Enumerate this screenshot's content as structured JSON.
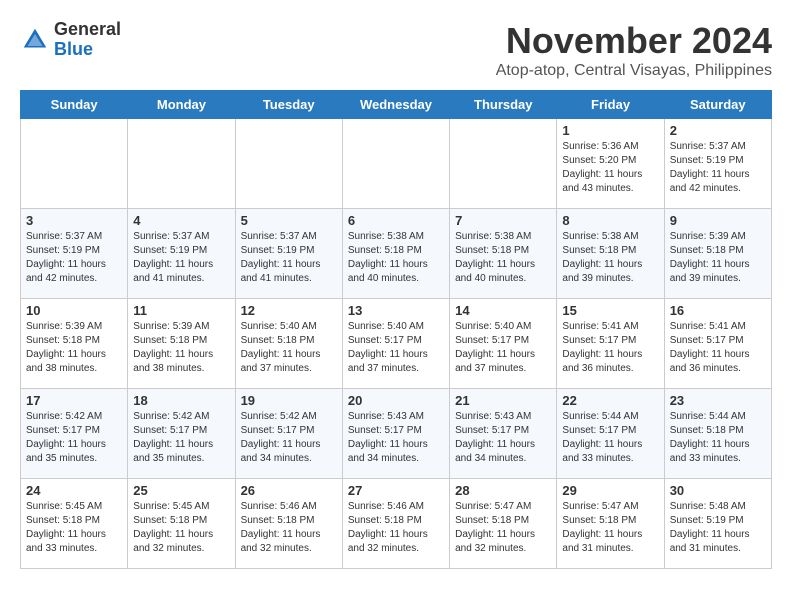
{
  "header": {
    "logo_line1": "General",
    "logo_line2": "Blue",
    "month_year": "November 2024",
    "location": "Atop-atop, Central Visayas, Philippines"
  },
  "days_of_week": [
    "Sunday",
    "Monday",
    "Tuesday",
    "Wednesday",
    "Thursday",
    "Friday",
    "Saturday"
  ],
  "weeks": [
    [
      {
        "day": "",
        "info": ""
      },
      {
        "day": "",
        "info": ""
      },
      {
        "day": "",
        "info": ""
      },
      {
        "day": "",
        "info": ""
      },
      {
        "day": "",
        "info": ""
      },
      {
        "day": "1",
        "info": "Sunrise: 5:36 AM\nSunset: 5:20 PM\nDaylight: 11 hours and 43 minutes."
      },
      {
        "day": "2",
        "info": "Sunrise: 5:37 AM\nSunset: 5:19 PM\nDaylight: 11 hours and 42 minutes."
      }
    ],
    [
      {
        "day": "3",
        "info": "Sunrise: 5:37 AM\nSunset: 5:19 PM\nDaylight: 11 hours and 42 minutes."
      },
      {
        "day": "4",
        "info": "Sunrise: 5:37 AM\nSunset: 5:19 PM\nDaylight: 11 hours and 41 minutes."
      },
      {
        "day": "5",
        "info": "Sunrise: 5:37 AM\nSunset: 5:19 PM\nDaylight: 11 hours and 41 minutes."
      },
      {
        "day": "6",
        "info": "Sunrise: 5:38 AM\nSunset: 5:18 PM\nDaylight: 11 hours and 40 minutes."
      },
      {
        "day": "7",
        "info": "Sunrise: 5:38 AM\nSunset: 5:18 PM\nDaylight: 11 hours and 40 minutes."
      },
      {
        "day": "8",
        "info": "Sunrise: 5:38 AM\nSunset: 5:18 PM\nDaylight: 11 hours and 39 minutes."
      },
      {
        "day": "9",
        "info": "Sunrise: 5:39 AM\nSunset: 5:18 PM\nDaylight: 11 hours and 39 minutes."
      }
    ],
    [
      {
        "day": "10",
        "info": "Sunrise: 5:39 AM\nSunset: 5:18 PM\nDaylight: 11 hours and 38 minutes."
      },
      {
        "day": "11",
        "info": "Sunrise: 5:39 AM\nSunset: 5:18 PM\nDaylight: 11 hours and 38 minutes."
      },
      {
        "day": "12",
        "info": "Sunrise: 5:40 AM\nSunset: 5:18 PM\nDaylight: 11 hours and 37 minutes."
      },
      {
        "day": "13",
        "info": "Sunrise: 5:40 AM\nSunset: 5:17 PM\nDaylight: 11 hours and 37 minutes."
      },
      {
        "day": "14",
        "info": "Sunrise: 5:40 AM\nSunset: 5:17 PM\nDaylight: 11 hours and 37 minutes."
      },
      {
        "day": "15",
        "info": "Sunrise: 5:41 AM\nSunset: 5:17 PM\nDaylight: 11 hours and 36 minutes."
      },
      {
        "day": "16",
        "info": "Sunrise: 5:41 AM\nSunset: 5:17 PM\nDaylight: 11 hours and 36 minutes."
      }
    ],
    [
      {
        "day": "17",
        "info": "Sunrise: 5:42 AM\nSunset: 5:17 PM\nDaylight: 11 hours and 35 minutes."
      },
      {
        "day": "18",
        "info": "Sunrise: 5:42 AM\nSunset: 5:17 PM\nDaylight: 11 hours and 35 minutes."
      },
      {
        "day": "19",
        "info": "Sunrise: 5:42 AM\nSunset: 5:17 PM\nDaylight: 11 hours and 34 minutes."
      },
      {
        "day": "20",
        "info": "Sunrise: 5:43 AM\nSunset: 5:17 PM\nDaylight: 11 hours and 34 minutes."
      },
      {
        "day": "21",
        "info": "Sunrise: 5:43 AM\nSunset: 5:17 PM\nDaylight: 11 hours and 34 minutes."
      },
      {
        "day": "22",
        "info": "Sunrise: 5:44 AM\nSunset: 5:17 PM\nDaylight: 11 hours and 33 minutes."
      },
      {
        "day": "23",
        "info": "Sunrise: 5:44 AM\nSunset: 5:18 PM\nDaylight: 11 hours and 33 minutes."
      }
    ],
    [
      {
        "day": "24",
        "info": "Sunrise: 5:45 AM\nSunset: 5:18 PM\nDaylight: 11 hours and 33 minutes."
      },
      {
        "day": "25",
        "info": "Sunrise: 5:45 AM\nSunset: 5:18 PM\nDaylight: 11 hours and 32 minutes."
      },
      {
        "day": "26",
        "info": "Sunrise: 5:46 AM\nSunset: 5:18 PM\nDaylight: 11 hours and 32 minutes."
      },
      {
        "day": "27",
        "info": "Sunrise: 5:46 AM\nSunset: 5:18 PM\nDaylight: 11 hours and 32 minutes."
      },
      {
        "day": "28",
        "info": "Sunrise: 5:47 AM\nSunset: 5:18 PM\nDaylight: 11 hours and 32 minutes."
      },
      {
        "day": "29",
        "info": "Sunrise: 5:47 AM\nSunset: 5:18 PM\nDaylight: 11 hours and 31 minutes."
      },
      {
        "day": "30",
        "info": "Sunrise: 5:48 AM\nSunset: 5:19 PM\nDaylight: 11 hours and 31 minutes."
      }
    ]
  ]
}
